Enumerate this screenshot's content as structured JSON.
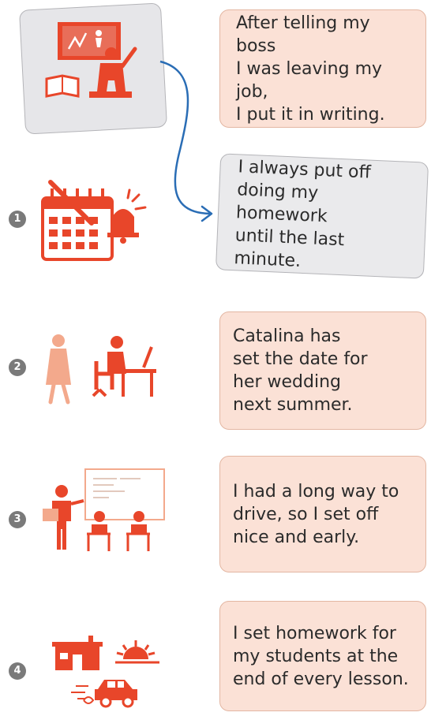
{
  "cards": [
    {
      "text": "After telling my boss\nI was leaving my job,\nI put it in writing."
    },
    {
      "text": "I always put off\ndoing my homework\nuntil the last minute."
    },
    {
      "text": "Catalina has\nset the date for\nher wedding\nnext summer."
    },
    {
      "text": "I had a long way to\ndrive, so I set off\nnice and early."
    },
    {
      "text": "I set homework for\nmy students at the\nend of every lesson."
    }
  ],
  "numbers": [
    "1",
    "2",
    "3",
    "4"
  ],
  "colors": {
    "accent": "#e8462a",
    "light_accent": "#f3a98c",
    "card_peach": "#fbe1d6",
    "card_gray": "#eaeaec",
    "arrow": "#2a6db5"
  },
  "icons": [
    "teacher-board-icon",
    "calendar-bell-icon",
    "bride-desk-icon",
    "classroom-icon",
    "house-sunset-car-icon"
  ]
}
